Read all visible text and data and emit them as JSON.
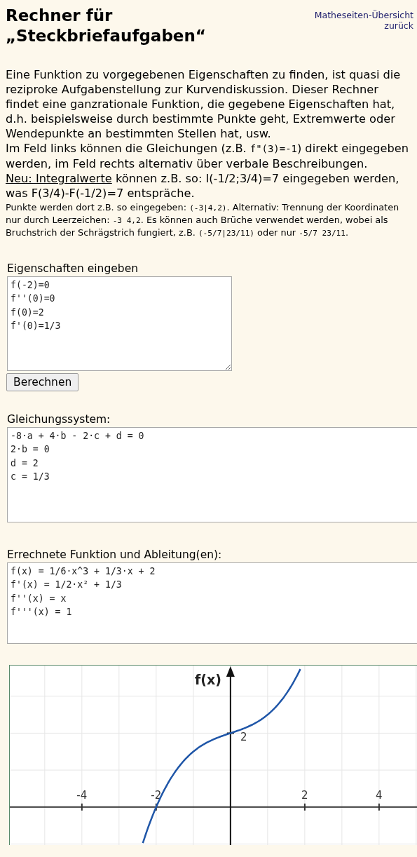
{
  "header": {
    "title": "Rechner für „Steckbriefaufgaben“",
    "links": [
      "Matheseiten-Übersicht",
      "zurück"
    ]
  },
  "intro": [
    [
      {
        "kind": "text",
        "text": "Eine Funktion zu vorgegebenen Eigenschaften zu finden, ist quasi die reziproke Aufgabenstellung zur Kurvendiskussion. Dieser Rechner findet eine ganzrationale Funktion, die gegebene Eigenschaften hat, d.h. beispielsweise durch bestimmte Punkte geht, Extremwerte oder Wendepunkte an bestimmten Stellen hat, usw."
      }
    ],
    [
      {
        "kind": "text",
        "text": "Im Feld links können die Gleichungen (z.B. "
      },
      {
        "kind": "code",
        "text": "f\"(3)=-1"
      },
      {
        "kind": "text",
        "text": ") direkt eingegeben werden, im Feld rechts alternativ über verbale Beschreibungen."
      }
    ],
    [
      {
        "kind": "underline",
        "text": "Neu: Integralwerte"
      },
      {
        "kind": "text",
        "text": " können z.B. so: I(-1/2;3/4)=7 eingegeben werden, was F(3/4)-F(-1/2)=7 entspräche."
      }
    ]
  ],
  "note": [
    {
      "kind": "text",
      "text": "Punkte werden dort z.B. so eingegeben: "
    },
    {
      "kind": "code",
      "text": "(-3|4,2)"
    },
    {
      "kind": "text",
      "text": ". Alternativ: Trennung der Koordinaten nur durch Leerzeichen: "
    },
    {
      "kind": "code",
      "text": "-3 4,2"
    },
    {
      "kind": "text",
      "text": ". Es können auch Brüche verwendet werden, wobei als Bruchstrich der Schrägstrich fungiert, z.B. "
    },
    {
      "kind": "code",
      "text": "(-5/7|23/11)"
    },
    {
      "kind": "text",
      "text": " oder nur "
    },
    {
      "kind": "code",
      "text": "-5/7 23/11"
    },
    {
      "kind": "text",
      "text": "."
    }
  ],
  "input": {
    "label": "Eigenschaften eingeben",
    "value": "f(-2)=0\nf''(0)=0\nf(0)=2\nf'(0)=1/3"
  },
  "button": "Berechnen",
  "system": {
    "label": "Gleichungssystem:",
    "value": "-8·a + 4·b - 2·c + d = 0\n2·b = 0\nd = 2\nc = 1/3"
  },
  "result": {
    "label": "Errechnete Funktion und Ableitung(en):",
    "value": "f(x) = 1/6·x^3 + 1/3·x + 2\nf'(x) = 1/2·x² + 1/3\nf''(x) = x\nf'''(x) = 1"
  },
  "plot": {
    "axis_label": "f(x)",
    "x_tick_labels": [
      "-4",
      "-2",
      "2",
      "4"
    ],
    "y_tick_labels": [
      "2"
    ]
  }
}
